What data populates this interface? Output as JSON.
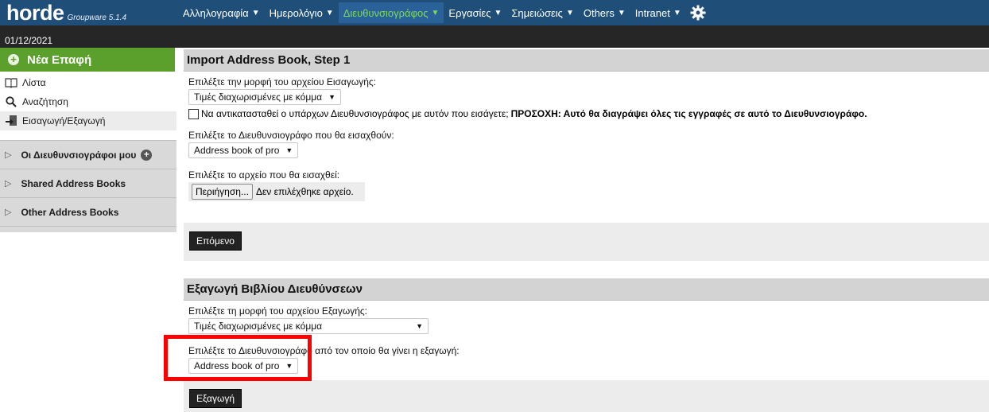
{
  "header": {
    "logo": "horde",
    "logo_sub": "Groupware 5.1.4",
    "menu": [
      {
        "label": "Αλληλογραφία",
        "active": false
      },
      {
        "label": "Ημερολόγιο",
        "active": false
      },
      {
        "label": "Διευθυνσιογράφος",
        "active": true
      },
      {
        "label": "Εργασίες",
        "active": false
      },
      {
        "label": "Σημειώσεις",
        "active": false
      },
      {
        "label": "Others",
        "active": false
      },
      {
        "label": "Intranet",
        "active": false
      }
    ],
    "settings_icon": "gear-icon",
    "date": "01/12/2021"
  },
  "sidebar": {
    "new_contact": "Νέα Επαφή",
    "links": [
      {
        "label": "Λίστα",
        "icon": "book-icon"
      },
      {
        "label": "Αναζήτηση",
        "icon": "search-icon"
      },
      {
        "label": "Εισαγωγή/Εξαγωγή",
        "icon": "import-export-icon"
      }
    ],
    "groups": [
      {
        "label": "Οι Διευθυνσιογράφοι μου"
      },
      {
        "label": "Shared Address Books"
      },
      {
        "label": "Other Address Books"
      }
    ]
  },
  "import_section": {
    "title": "Import Address Book, Step 1",
    "format_label": "Επιλέξτε την μορφή του αρχείου Εισαγωγής:",
    "format_value": "Τιμές διαχωρισμένες με κόμμα",
    "replace_label": "Να αντικατασταθεί ο υπάρχων Διευθυνσιογράφος με αυτόν που εισάγετε;",
    "replace_warning": "ΠΡΟΣΟΧΗ: Αυτό θα διαγράψει όλες τις εγγραφές σε αυτό το Διευθυνσιογράφο.",
    "target_label": "Επιλέξτε το Διευθυνσιογράφο που θα εισαχθούν:",
    "target_value": "Address book of pro",
    "file_label": "Επιλέξτε το αρχείο που θα εισαχθεί:",
    "browse_label": "Περιήγηση...",
    "no_file": "Δεν επιλέχθηκε αρχείο.",
    "next_button": "Επόμενο"
  },
  "export_section": {
    "title": "Εξαγωγή Βιβλίου Διευθύνσεων",
    "format_label": "Επιλέξτε τη μορφή του αρχείου Εξαγωγής:",
    "format_value": "Τιμές διαχωρισμένες με κόμμα",
    "source_label": "Επιλέξτε το Διευθυνσιογράφο από τον οποίο θα γίνει η εξαγωγή:",
    "source_value": "Address book of pro",
    "export_button": "Εξαγωγή"
  },
  "colors": {
    "topbar": "#1f4e79",
    "accent_green": "#5b9f2d",
    "highlight": "#ff0000"
  }
}
